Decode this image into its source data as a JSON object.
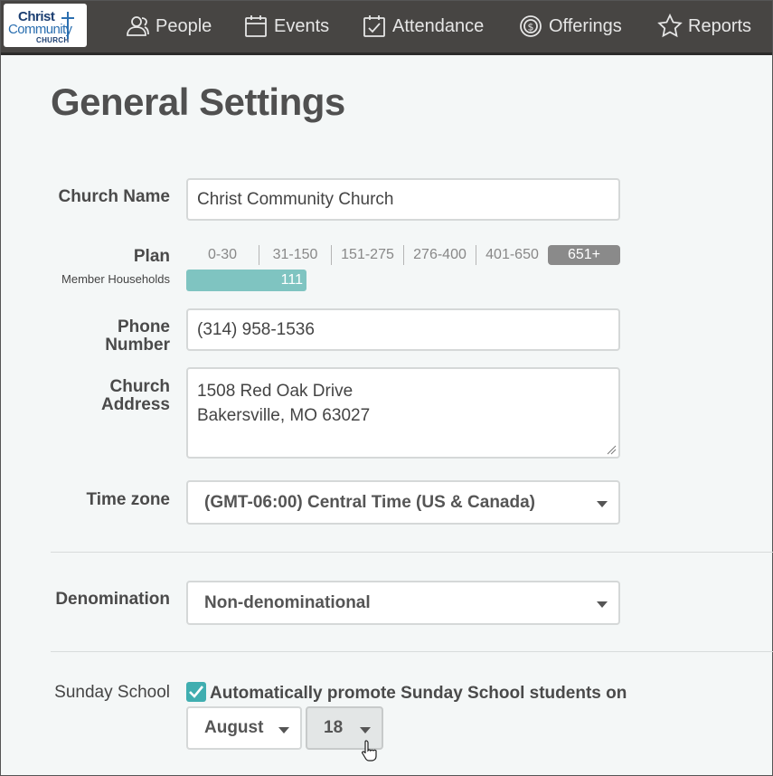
{
  "logo": {
    "line1": "Christ",
    "line2": "Community",
    "line3": "CHURCH"
  },
  "nav": [
    {
      "label": "People",
      "icon": "people-icon"
    },
    {
      "label": "Events",
      "icon": "calendar-icon"
    },
    {
      "label": "Attendance",
      "icon": "checklist-icon"
    },
    {
      "label": "Offerings",
      "icon": "dollar-icon"
    },
    {
      "label": "Reports",
      "icon": "star-icon"
    }
  ],
  "page": {
    "title": "General Settings"
  },
  "church_name": {
    "label": "Church Name",
    "value": "Christ Community Church"
  },
  "plan": {
    "label": "Plan",
    "sublabel": "Member Households",
    "tiers": [
      "0-30",
      "31-150",
      "151-275",
      "276-400",
      "401-650",
      "651+"
    ],
    "active_tier": "651+",
    "households": "111"
  },
  "phone": {
    "label_line1": "Phone",
    "label_line2": "Number",
    "value": "(314) 958-1536"
  },
  "address": {
    "label_line1": "Church",
    "label_line2": "Address",
    "line1": "1508 Red Oak Drive",
    "line2": "Bakersville, MO 63027"
  },
  "timezone": {
    "label": "Time zone",
    "value": "(GMT-06:00) Central Time (US & Canada)"
  },
  "denomination": {
    "label": "Denomination",
    "value": "Non-denominational"
  },
  "sunday_school": {
    "label": "Sunday School",
    "checkbox_text": "Automatically promote Sunday School students on",
    "checked": true,
    "month": "August",
    "day": "18"
  },
  "colors": {
    "nav_bg": "#474543",
    "accent_teal": "#7fc4c1",
    "active_tier_bg": "#8a8a8a"
  }
}
